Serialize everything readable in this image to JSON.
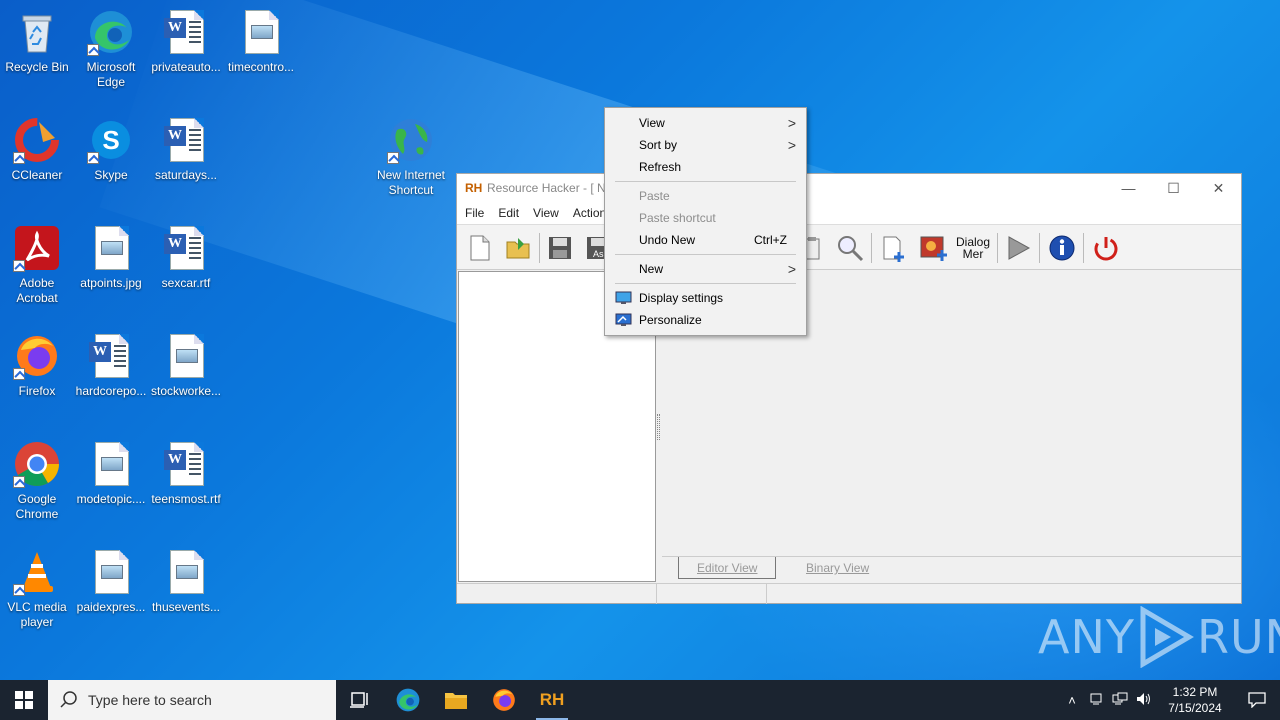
{
  "desktop": {
    "icons": [
      {
        "label": "Recycle Bin"
      },
      {
        "label": "Microsoft Edge"
      },
      {
        "label": "privateauto..."
      },
      {
        "label": "timecontro..."
      },
      {
        "label": "CCleaner"
      },
      {
        "label": "Skype"
      },
      {
        "label": "saturdays..."
      },
      {
        "label": "New Internet Shortcut"
      },
      {
        "label": "Adobe Acrobat"
      },
      {
        "label": "atpoints.jpg"
      },
      {
        "label": "sexcar.rtf"
      },
      {
        "label": "Firefox"
      },
      {
        "label": "hardcorepo..."
      },
      {
        "label": "stockworke..."
      },
      {
        "label": "Google Chrome"
      },
      {
        "label": "modetopic...."
      },
      {
        "label": "teensmost.rtf"
      },
      {
        "label": "VLC media player"
      },
      {
        "label": "paidexpres..."
      },
      {
        "label": "thusevents..."
      }
    ]
  },
  "rh_window": {
    "logo": "RH",
    "title": "Resource Hacker - [ Ne",
    "menu": [
      "File",
      "Edit",
      "View",
      "Action"
    ],
    "toolbar_dialog_label": "Dialog Mer",
    "tabs": [
      "Editor View",
      "Binary View"
    ]
  },
  "context_menu": {
    "items": [
      {
        "label": "View",
        "submenu": true,
        "disabled": false
      },
      {
        "label": "Sort by",
        "submenu": true,
        "disabled": false
      },
      {
        "label": "Refresh",
        "disabled": false
      },
      {
        "label": "Paste",
        "disabled": true
      },
      {
        "label": "Paste shortcut",
        "disabled": true
      },
      {
        "label": "Undo New",
        "shortcut": "Ctrl+Z",
        "disabled": false
      },
      {
        "label": "New",
        "submenu": true,
        "disabled": false
      },
      {
        "label": "Display settings",
        "icon": "display-icon",
        "disabled": false
      },
      {
        "label": "Personalize",
        "icon": "personalize-icon",
        "disabled": false
      }
    ],
    "arrow_glyph": ">"
  },
  "watermark": {
    "text_left": "ANY",
    "text_right": "RUN"
  },
  "taskbar": {
    "search_placeholder": "Type here to search",
    "rh_label": "RH",
    "time": "1:32 PM",
    "date": "7/15/2024"
  },
  "colors": {
    "accent": "#0b78dc",
    "taskbar": "#1b2430",
    "menu_bg": "#f2f2f2"
  }
}
